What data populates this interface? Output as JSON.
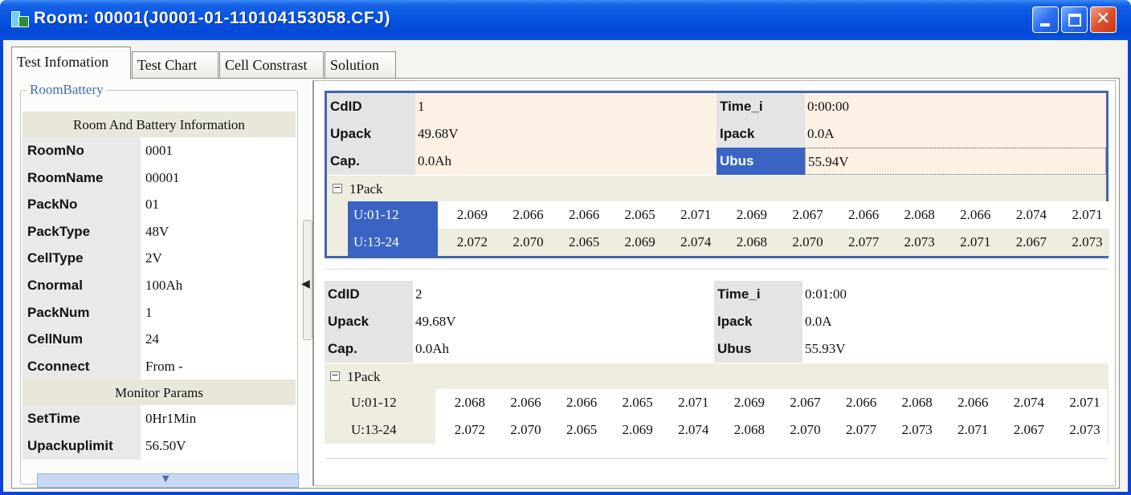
{
  "window": {
    "title": "Room: 00001(J0001-01-110104153058.CFJ)"
  },
  "tabs": [
    "Test Infomation",
    "Test Chart",
    "Cell Constrast",
    "Solution"
  ],
  "left_group": {
    "title": "RoomBattery",
    "section1": "Room And Battery Information",
    "rows1": [
      {
        "label": "RoomNo",
        "value": "0001"
      },
      {
        "label": "RoomName",
        "value": " 00001"
      },
      {
        "label": "PackNo",
        "value": "01"
      },
      {
        "label": "PackType",
        "value": "48V"
      },
      {
        "label": "CellType",
        "value": "2V"
      },
      {
        "label": "Cnormal",
        "value": "100Ah"
      },
      {
        "label": "PackNum",
        "value": "1"
      },
      {
        "label": "CellNum",
        "value": "24"
      },
      {
        "label": "Cconnect",
        "value": "From -"
      }
    ],
    "section2": "Monitor Params",
    "rows2": [
      {
        "label": "SetTime",
        "value": "0Hr1Min"
      },
      {
        "label": "Upackuplimit",
        "value": "56.50V"
      }
    ]
  },
  "cards": [
    {
      "cdid_label": "CdID",
      "cdid": "1",
      "upack_label": "Upack",
      "upack": "49.68V",
      "cap_label": "Cap.",
      "cap": "0.0Ah",
      "time_label": "Time_i",
      "time": "0:00:00",
      "ipack_label": "Ipack",
      "ipack": "0.0A",
      "ubus_label": "Ubus",
      "ubus": "55.94V",
      "pack": "1Pack",
      "row1_label": "U:01-12",
      "row1": [
        "2.069",
        "2.066",
        "2.066",
        "2.065",
        "2.071",
        "2.069",
        "2.067",
        "2.066",
        "2.068",
        "2.066",
        "2.074",
        "2.071"
      ],
      "row2_label": "U:13-24",
      "row2": [
        "2.072",
        "2.070",
        "2.065",
        "2.069",
        "2.074",
        "2.068",
        "2.070",
        "2.077",
        "2.073",
        "2.071",
        "2.067",
        "2.073"
      ]
    },
    {
      "cdid_label": "CdID",
      "cdid": "2",
      "upack_label": "Upack",
      "upack": "49.68V",
      "cap_label": "Cap.",
      "cap": "0.0Ah",
      "time_label": "Time_i",
      "time": "0:01:00",
      "ipack_label": "Ipack",
      "ipack": "0.0A",
      "ubus_label": "Ubus",
      "ubus": "55.93V",
      "pack": "1Pack",
      "row1_label": "U:01-12",
      "row1": [
        "2.068",
        "2.066",
        "2.066",
        "2.065",
        "2.071",
        "2.069",
        "2.067",
        "2.066",
        "2.068",
        "2.066",
        "2.074",
        "2.071"
      ],
      "row2_label": "U:13-24",
      "row2": [
        "2.072",
        "2.070",
        "2.065",
        "2.069",
        "2.074",
        "2.068",
        "2.070",
        "2.077",
        "2.073",
        "2.071",
        "2.067",
        "2.073"
      ]
    }
  ],
  "colors": {
    "title_bar": "#0654e0",
    "selection": "#3a64c4",
    "selected_card_bg": "#fdf0e4",
    "group_title": "#3b6bb4"
  },
  "icons": {
    "app": "app-icon",
    "minimize": "minimize-icon",
    "maximize": "maximize-icon",
    "close": "close-icon",
    "collapse": "collapse-left-icon",
    "scroll": "scroll-down-icon",
    "expand": "tree-minus-icon"
  }
}
